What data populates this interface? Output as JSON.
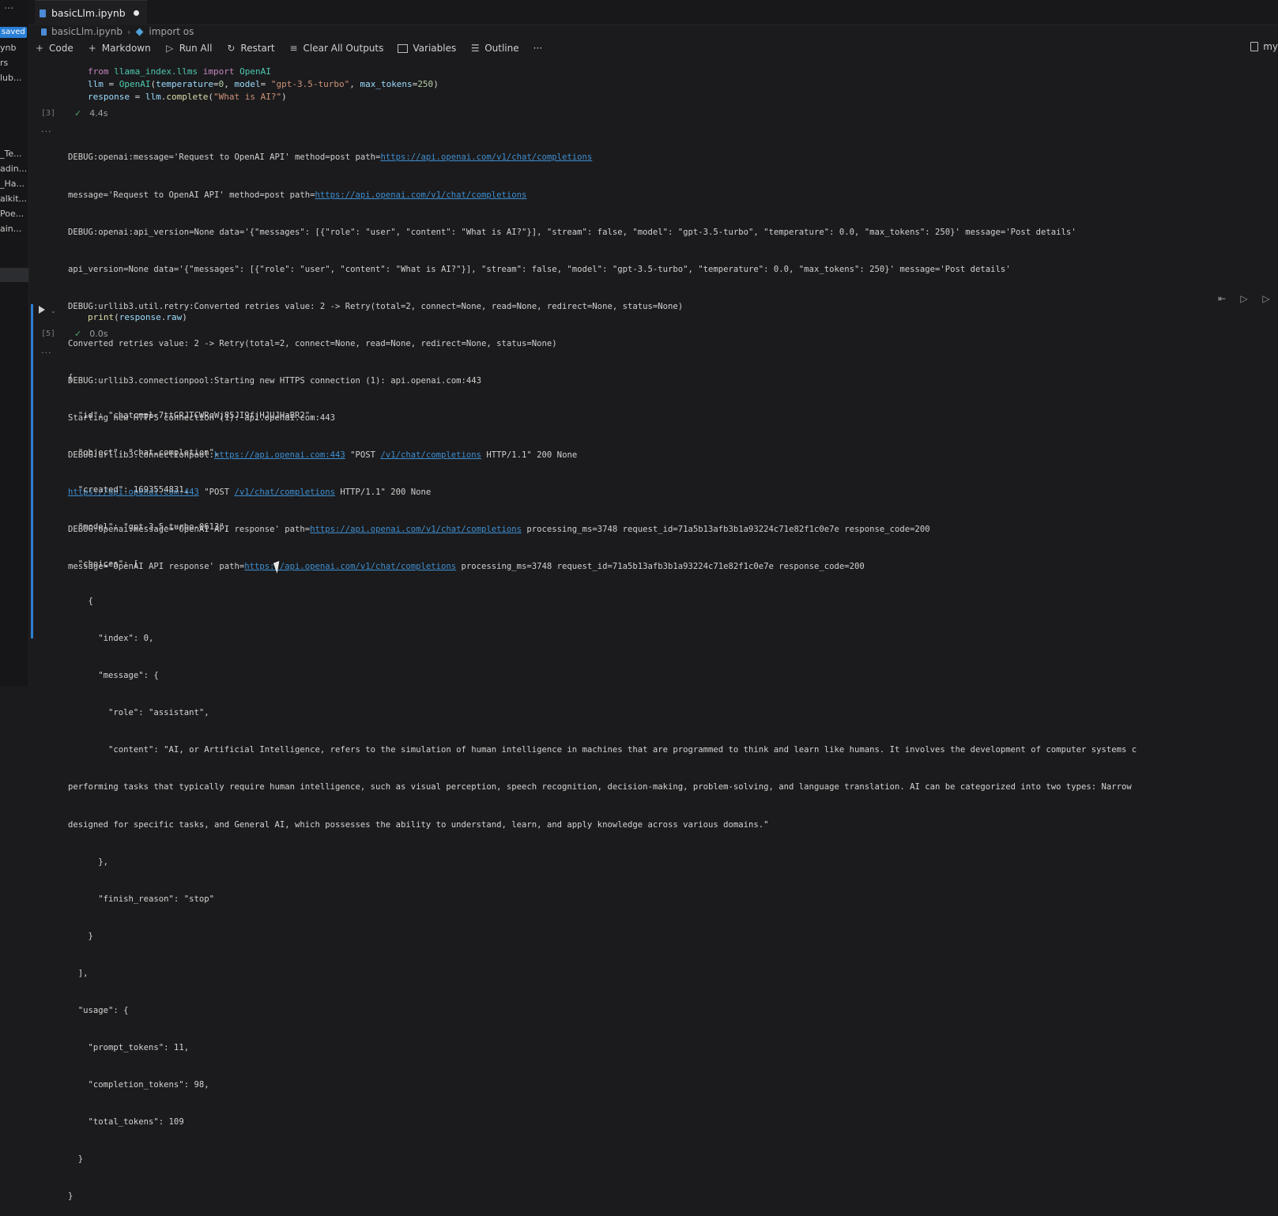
{
  "explorer": {
    "dots": "···",
    "saved_badge": "saved",
    "items": [
      "ynb",
      "rs",
      "lub...",
      "_Te...",
      "adin...",
      "_Ha...",
      "alkit...",
      "Poe...",
      "ain..."
    ]
  },
  "tab": {
    "title": "basicLlm.ipynb"
  },
  "breadcrumb": {
    "file": "basicLlm.ipynb",
    "symbol": "import os"
  },
  "toolbar": {
    "code": "Code",
    "markdown": "Markdown",
    "run_all": "Run All",
    "restart": "Restart",
    "clear_outputs": "Clear All Outputs",
    "variables": "Variables",
    "outline": "Outline",
    "more": "···",
    "kernel": "my"
  },
  "cell1": {
    "exec_count": "[3]",
    "duration": "4.4s",
    "code": {
      "line1": {
        "kw1": "from",
        "mod": "llama_index.llms",
        "kw2": "import",
        "cls": "OpenAI"
      },
      "line2": {
        "var1": "llm",
        "eq": " = ",
        "cls": "OpenAI",
        "open": "(",
        "p1": "temperature",
        "eq1": "=",
        "v1": "0",
        "c1": ", ",
        "p2": "model",
        "eq2": "= ",
        "v2": "\"gpt-3.5-turbo\"",
        "c2": ", ",
        "p3": "max_tokens",
        "eq3": "=",
        "v3": "250",
        "close": ")"
      },
      "line3": {
        "var1": "response",
        "eq": " = ",
        "obj": "llm",
        "dot": ".",
        "fn": "complete",
        "open": "(",
        "arg": "\"What is AI?\"",
        "close": ")"
      }
    },
    "log": {
      "l1": {
        "a": "DEBUG:openai:message='Request to OpenAI API' method=post path=",
        "link": "https://api.openai.com/v1/chat/completions"
      },
      "l2": {
        "a": "message='Request to OpenAI API' method=post path=",
        "link": "https://api.openai.com/v1/chat/completions"
      },
      "l3": "DEBUG:openai:api_version=None data='{\"messages\": [{\"role\": \"user\", \"content\": \"What is AI?\"}], \"stream\": false, \"model\": \"gpt-3.5-turbo\", \"temperature\": 0.0, \"max_tokens\": 250}' message='Post details'",
      "l4": "api_version=None data='{\"messages\": [{\"role\": \"user\", \"content\": \"What is AI?\"}], \"stream\": false, \"model\": \"gpt-3.5-turbo\", \"temperature\": 0.0, \"max_tokens\": 250}' message='Post details'",
      "l5": "DEBUG:urllib3.util.retry:Converted retries value: 2 -> Retry(total=2, connect=None, read=None, redirect=None, status=None)",
      "l6": "Converted retries value: 2 -> Retry(total=2, connect=None, read=None, redirect=None, status=None)",
      "l7": "DEBUG:urllib3.connectionpool:Starting new HTTPS connection (1): api.openai.com:443",
      "l8": "Starting new HTTPS connection (1): api.openai.com:443",
      "l9": {
        "a": "DEBUG:urllib3.connectionpool:",
        "link1": "https://api.openai.com:443",
        "b": " \"POST ",
        "link2": "/v1/chat/completions",
        "c": " HTTP/1.1\" 200 None"
      },
      "l10": {
        "link1": "https://api.openai.com:443",
        "b": " \"POST ",
        "link2": "/v1/chat/completions",
        "c": " HTTP/1.1\" 200 None"
      },
      "l11": {
        "a": "DEBUG:openai:message='OpenAI API response' path=",
        "link": "https://api.openai.com/v1/chat/completions",
        "b": " processing_ms=3748 request_id=71a5b13afb3b1a93224c71e82f1c0e7e response_code=200"
      },
      "l12": {
        "a": "message='OpenAI API response' path=",
        "link": "https://api.openai.com/v1/chat/completions",
        "b": " processing_ms=3748 request_id=71a5b13afb3b1a93224c71e82f1c0e7e response_code=200"
      }
    }
  },
  "cell2": {
    "exec_count": "[5]",
    "duration": "0.0s",
    "code": {
      "fn": "print",
      "open": "(",
      "obj": "response",
      "dot": ".",
      "attr": "raw",
      "close": ")"
    },
    "output": [
      "{",
      "  \"id\": \"chatcmpl-7ttGRJTCWRqWj85JI9fjHJUJHaBR2\",",
      "  \"object\": \"chat.completion\",",
      "  \"created\": 1693554831,",
      "  \"model\": \"gpt-3.5-turbo-0613\",",
      "  \"choices\": [",
      "    {",
      "      \"index\": 0,",
      "      \"message\": {",
      "        \"role\": \"assistant\",",
      "        \"content\": \"AI, or Artificial Intelligence, refers to the simulation of human intelligence in machines that are programmed to think and learn like humans. It involves the development of computer systems c",
      "performing tasks that typically require human intelligence, such as visual perception, speech recognition, decision-making, problem-solving, and language translation. AI can be categorized into two types: Narrow",
      "designed for specific tasks, and General AI, which possesses the ability to understand, learn, and apply knowledge across various domains.\"",
      "      },",
      "      \"finish_reason\": \"stop\"",
      "    }",
      "  ],",
      "  \"usage\": {",
      "    \"prompt_tokens\": 11,",
      "    \"completion_tokens\": 98,",
      "    \"total_tokens\": 109",
      "  }",
      "}"
    ]
  }
}
